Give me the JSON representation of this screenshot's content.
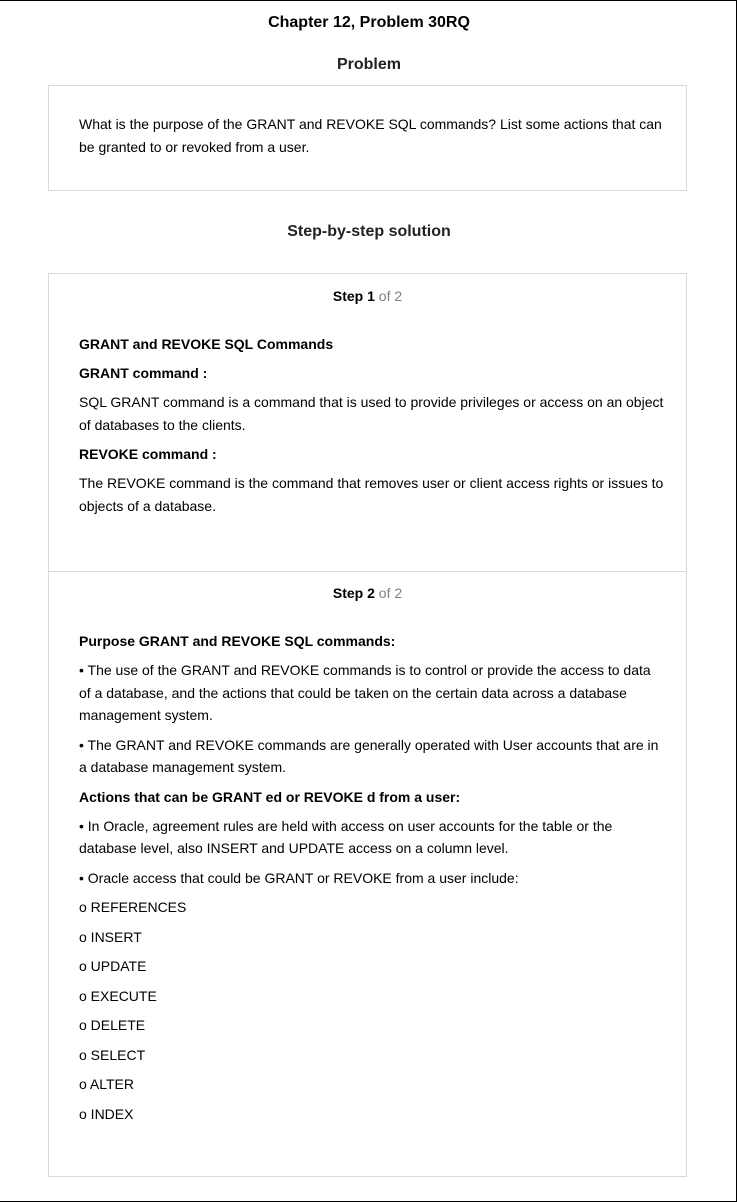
{
  "header": {
    "title": "Chapter 12, Problem 30RQ"
  },
  "problem": {
    "heading": "Problem",
    "text": "What is the purpose of the GRANT and REVOKE SQL commands? List some actions that can be granted to or revoked from a user."
  },
  "solution": {
    "heading": "Step-by-step solution",
    "steps": [
      {
        "label": "Step",
        "number": "1",
        "of_text": "of 2",
        "blocks": [
          {
            "type": "heading",
            "text": "GRANT and REVOKE SQL Commands"
          },
          {
            "type": "heading",
            "text": "GRANT command :"
          },
          {
            "type": "paragraph",
            "text": "SQL GRANT command is a command that is used to provide privileges or access on an object of databases to the clients."
          },
          {
            "type": "heading",
            "text": "REVOKE command :"
          },
          {
            "type": "paragraph",
            "text": "The REVOKE command is the command that removes user or client access rights or issues to objects of a database."
          }
        ]
      },
      {
        "label": "Step",
        "number": "2",
        "of_text": "of 2",
        "blocks": [
          {
            "type": "heading",
            "text": "Purpose GRANT and REVOKE SQL commands:"
          },
          {
            "type": "paragraph",
            "text": "• The use of the GRANT and REVOKE commands is to control or provide the access to data of a database, and the actions that could be taken on the certain data across a database management system."
          },
          {
            "type": "paragraph",
            "text": "• The GRANT and REVOKE commands are generally operated with User accounts that are in a database management system."
          },
          {
            "type": "heading",
            "text": "Actions that can be GRANT ed or REVOKE d from a user:"
          },
          {
            "type": "paragraph",
            "text": "• In Oracle, agreement rules are held with access on user accounts for the table or the database level, also INSERT and UPDATE access on a column level."
          },
          {
            "type": "paragraph",
            "text": "• Oracle access that could be GRANT or REVOKE from a user include:"
          },
          {
            "type": "item",
            "text": "o REFERENCES"
          },
          {
            "type": "item",
            "text": "o INSERT"
          },
          {
            "type": "item",
            "text": "o UPDATE"
          },
          {
            "type": "item",
            "text": "o EXECUTE"
          },
          {
            "type": "item",
            "text": "o DELETE"
          },
          {
            "type": "item",
            "text": "o SELECT"
          },
          {
            "type": "item",
            "text": "o ALTER"
          },
          {
            "type": "item",
            "text": "o INDEX"
          }
        ]
      }
    ]
  }
}
